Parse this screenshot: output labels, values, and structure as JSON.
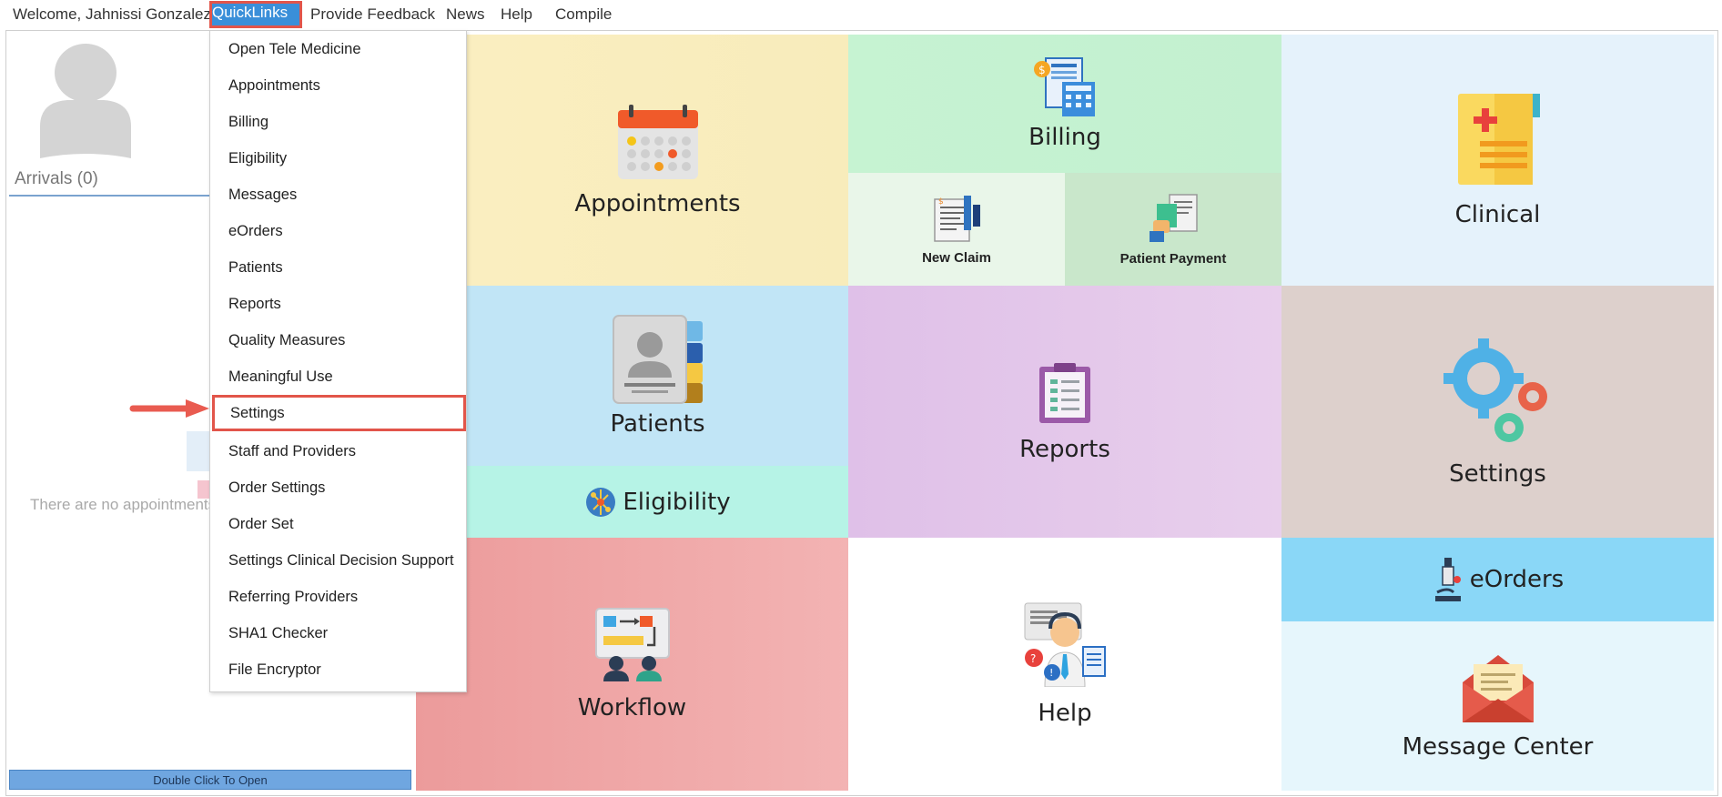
{
  "topbar": {
    "welcome": "Welcome, Jahnissi Gonzalez",
    "quicklinks": "QuickLinks",
    "feedback": "Provide Feedback",
    "news": "News",
    "help": "Help",
    "compile": "Compile"
  },
  "left_panel": {
    "arrivals": "Arrivals (0)",
    "empty_text": "There are no appointments",
    "double_click": "Double Click To Open"
  },
  "quicklinks_menu": {
    "items": [
      "Open Tele Medicine",
      "Appointments",
      "Billing",
      "Eligibility",
      "Messages",
      "eOrders",
      "Patients",
      "Reports",
      "Quality Measures",
      "Meaningful Use",
      "Settings",
      "Staff and Providers",
      "Order Settings",
      "Order Set",
      "Settings Clinical Decision Support",
      "Referring Providers",
      "SHA1 Checker",
      "File Encryptor"
    ],
    "highlighted": "Settings"
  },
  "tiles": {
    "appointments": "Appointments",
    "billing": "Billing",
    "new_claim": "New Claim",
    "patient_payment": "Patient Payment",
    "clinical": "Clinical",
    "patients": "Patients",
    "eligibility": "Eligibility",
    "reports": "Reports",
    "settings": "Settings",
    "workflow": "Workflow",
    "help": "Help",
    "eorders": "eOrders",
    "message_center": "Message Center"
  },
  "colors": {
    "highlight_border": "#e2554a",
    "quicklinks_bg": "#3a8fd9"
  }
}
